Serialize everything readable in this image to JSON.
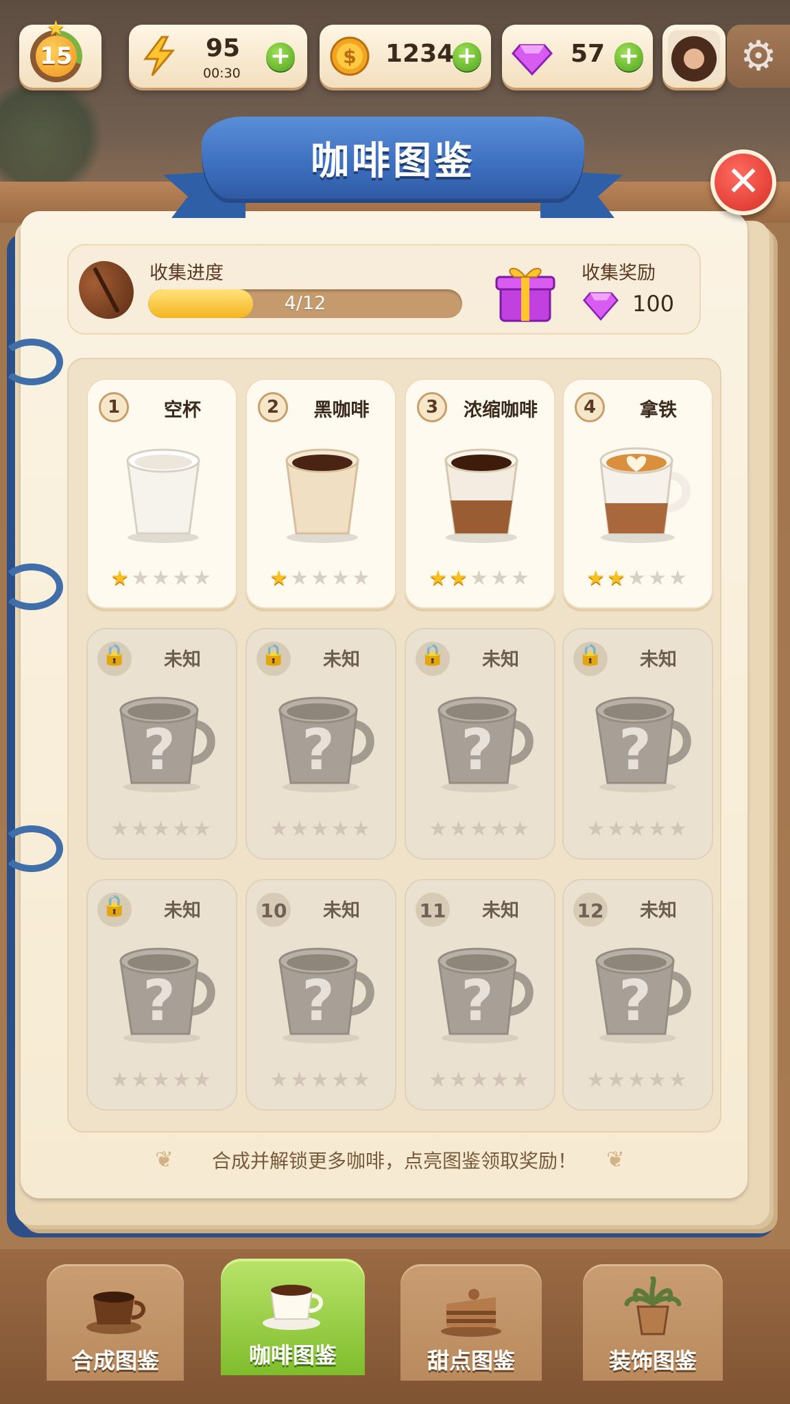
{
  "top_bar": {
    "level": "15",
    "energy": {
      "value": "95",
      "timer": "00:30"
    },
    "coins": {
      "value": "1234"
    },
    "gems": {
      "value": "57"
    }
  },
  "title": "咖啡图鉴",
  "progress": {
    "label": "收集进度",
    "text": "4/12",
    "collected": 4,
    "total": 12,
    "reward_label": "收集奖励",
    "reward_value": "100"
  },
  "cards": [
    {
      "num": "1",
      "name": "空杯",
      "stars": 1,
      "locked": false,
      "img": "empty-cup"
    },
    {
      "num": "2",
      "name": "黑咖啡",
      "stars": 1,
      "locked": false,
      "img": "black-coffee"
    },
    {
      "num": "3",
      "name": "浓缩咖啡",
      "stars": 2,
      "locked": false,
      "img": "espresso"
    },
    {
      "num": "4",
      "name": "拿铁",
      "stars": 2,
      "locked": false,
      "img": "latte"
    },
    {
      "num": "",
      "name": "未知",
      "stars": 0,
      "locked": true
    },
    {
      "num": "",
      "name": "未知",
      "stars": 0,
      "locked": true
    },
    {
      "num": "",
      "name": "未知",
      "stars": 0,
      "locked": true
    },
    {
      "num": "",
      "name": "未知",
      "stars": 0,
      "locked": true
    },
    {
      "num": "",
      "name": "未知",
      "stars": 0,
      "locked": true
    },
    {
      "num": "10",
      "name": "未知",
      "stars": 0,
      "locked": true
    },
    {
      "num": "11",
      "name": "未知",
      "stars": 0,
      "locked": true
    },
    {
      "num": "12",
      "name": "未知",
      "stars": 0,
      "locked": true
    }
  ],
  "hint": "合成并解锁更多咖啡，点亮图鉴领取奖励！",
  "tabs": [
    {
      "label": "合成图鉴",
      "active": false,
      "icon": "coffee-cup-icon"
    },
    {
      "label": "咖啡图鉴",
      "active": true,
      "icon": "latte-cup-icon"
    },
    {
      "label": "甜点图鉴",
      "active": false,
      "icon": "cake-icon"
    },
    {
      "label": "装饰图鉴",
      "active": false,
      "icon": "potted-plant-icon"
    }
  ],
  "colors": {
    "accent_blue": "#3d6fc0",
    "star": "#f7bf1f",
    "active_tab": "#7fbd2c"
  }
}
